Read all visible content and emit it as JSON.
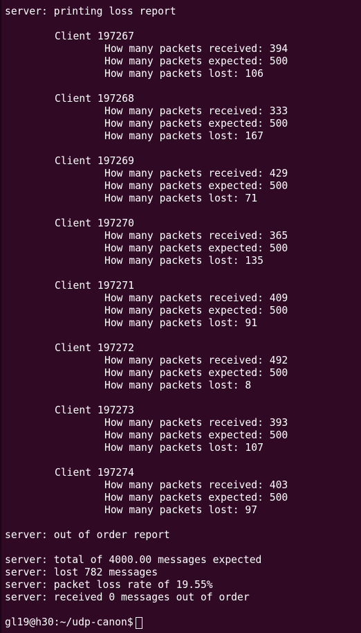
{
  "header_line": "server: printing loss report",
  "clients": [
    {
      "title": "Client 197267",
      "received": "How many packets received: 394",
      "expected": "How many packets expected: 500",
      "lost": "How many packets lost: 106"
    },
    {
      "title": "Client 197268",
      "received": "How many packets received: 333",
      "expected": "How many packets expected: 500",
      "lost": "How many packets lost: 167"
    },
    {
      "title": "Client 197269",
      "received": "How many packets received: 429",
      "expected": "How many packets expected: 500",
      "lost": "How many packets lost: 71"
    },
    {
      "title": "Client 197270",
      "received": "How many packets received: 365",
      "expected": "How many packets expected: 500",
      "lost": "How many packets lost: 135"
    },
    {
      "title": "Client 197271",
      "received": "How many packets received: 409",
      "expected": "How many packets expected: 500",
      "lost": "How many packets lost: 91"
    },
    {
      "title": "Client 197272",
      "received": "How many packets received: 492",
      "expected": "How many packets expected: 500",
      "lost": "How many packets lost: 8"
    },
    {
      "title": "Client 197273",
      "received": "How many packets received: 393",
      "expected": "How many packets expected: 500",
      "lost": "How many packets lost: 107"
    },
    {
      "title": "Client 197274",
      "received": "How many packets received: 403",
      "expected": "How many packets expected: 500",
      "lost": "How many packets lost: 97"
    }
  ],
  "order_report_line": "server: out of order report",
  "summary": [
    "server: total of 4000.00 messages expected",
    "server: lost 782 messages",
    "server: packet loss rate of 19.55%",
    "server: received 0 messages out of order"
  ],
  "prompt": "gl19@h30:~/udp-canon$",
  "colors": {
    "background": "#300a24",
    "text": "#ffffff"
  }
}
